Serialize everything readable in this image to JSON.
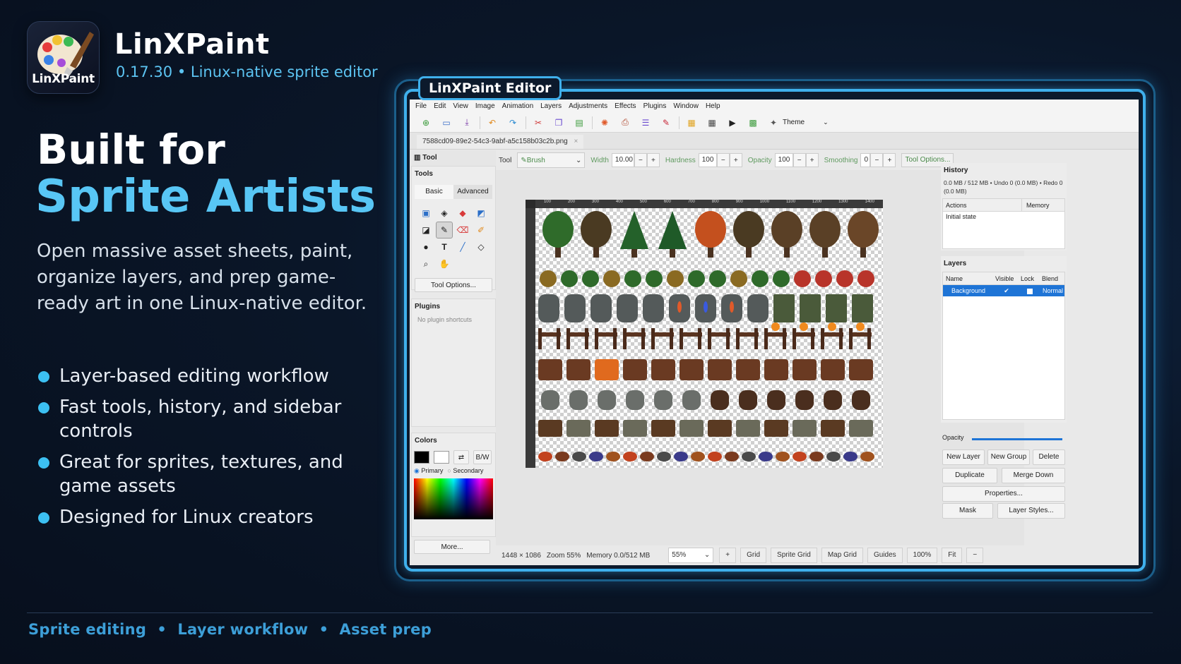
{
  "branding": {
    "logo_text": "LinXPaint",
    "app_name": "LinXPaint",
    "subtitle": "0.17.30 • Linux-native sprite editor"
  },
  "hero": {
    "headline_line1": "Built for",
    "headline_line2": "Sprite Artists",
    "lede": "Open massive asset sheets, paint, organize layers, and prep game-ready art in one Linux-native editor."
  },
  "bullets": [
    "Layer-based editing workflow",
    "Fast tools, history, and sidebar controls",
    "Great for sprites, textures, and game assets",
    "Designed for Linux creators"
  ],
  "footer": "Sprite editing  •  Layer workflow  •  Asset prep",
  "window": {
    "frame_title": "LinXPaint Editor",
    "menu": [
      "File",
      "Edit",
      "View",
      "Image",
      "Animation",
      "Layers",
      "Adjustments",
      "Effects",
      "Plugins",
      "Window",
      "Help"
    ],
    "theme_label": "Theme",
    "doc_tab": "7588cd09-89e2-54c3-9abf-a5c158b03c2b.png",
    "doc_tab_close": "×"
  },
  "left_dock": {
    "tool_header": "Tool",
    "tools_title": "Tools",
    "tab_basic": "Basic",
    "tab_advanced": "Advanced",
    "tool_options": "Tool Options...",
    "plugins_title": "Plugins",
    "plugins_empty": "No plugin shortcuts",
    "colors_title": "Colors",
    "swap_label": "⇄",
    "bw_label": "B/W",
    "primary_label": "Primary",
    "secondary_label": "Secondary",
    "more_label": "More...",
    "primary_color": "#000000",
    "secondary_color": "#ffffff"
  },
  "options_bar": {
    "tool_label": "Tool",
    "tool_value": "Brush",
    "width_label": "Width",
    "width_value": "10.00",
    "hardness_label": "Hardness",
    "hardness_value": "100",
    "opacity_label": "Opacity",
    "opacity_value": "100",
    "smoothing_label": "Smoothing",
    "smoothing_value": "0",
    "minus": "−",
    "plus": "+",
    "tool_options": "Tool Options..."
  },
  "status": {
    "size": "1448 × 1086",
    "zoom": "Zoom 55%",
    "memory": "Memory 0.0/512 MB",
    "zoom_select": "55%",
    "plus": "+",
    "grid": "Grid",
    "sprite_grid": "Sprite Grid",
    "map_grid": "Map Grid",
    "guides": "Guides",
    "hundred": "100%",
    "fit": "Fit",
    "minus": "−"
  },
  "history": {
    "title": "History",
    "info": "0.0 MB / 512 MB  •  Undo 0 (0.0 MB)  •  Redo 0 (0.0 MB)",
    "col_actions": "Actions",
    "col_memory": "Memory",
    "entries": [
      "Initial state"
    ]
  },
  "layers": {
    "title": "Layers",
    "col_name": "Name",
    "col_visible": "Visible",
    "col_lock": "Lock",
    "col_blend": "Blend",
    "rows": [
      {
        "name": "Background",
        "visible": "✔",
        "blend": "Normal"
      }
    ],
    "opacity_label": "Opacity",
    "opacity_value": 1.0,
    "buttons": {
      "new_layer": "New Layer",
      "new_group": "New Group",
      "delete": "Delete",
      "duplicate": "Duplicate",
      "merge_down": "Merge Down",
      "properties": "Properties...",
      "mask": "Mask",
      "layer_styles": "Layer Styles..."
    }
  },
  "ruler_ticks": [
    "100",
    "200",
    "300",
    "400",
    "500",
    "600",
    "700",
    "800",
    "900",
    "1000",
    "1100",
    "1200",
    "1300",
    "1400"
  ],
  "colors": {
    "accent": "#58c6f5",
    "frame": "#3fb0ec",
    "selection": "#1e74d6"
  }
}
